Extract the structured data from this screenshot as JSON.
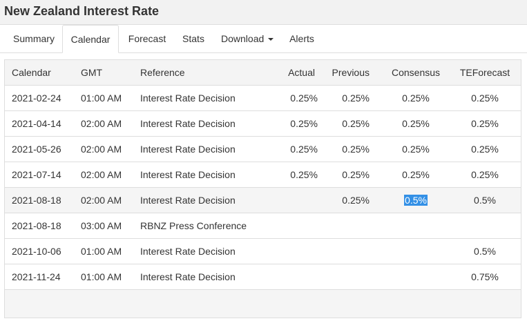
{
  "page": {
    "title": "New Zealand Interest Rate"
  },
  "tabs": [
    {
      "label": "Summary"
    },
    {
      "label": "Calendar"
    },
    {
      "label": "Forecast"
    },
    {
      "label": "Stats"
    },
    {
      "label": "Download"
    },
    {
      "label": "Alerts"
    }
  ],
  "table": {
    "headers": {
      "calendar": "Calendar",
      "gmt": "GMT",
      "reference": "Reference",
      "actual": "Actual",
      "previous": "Previous",
      "consensus": "Consensus",
      "teforecast": "TEForecast"
    },
    "rows": [
      {
        "calendar": "2021-02-24",
        "gmt": "01:00 AM",
        "reference": "Interest Rate Decision",
        "actual": "0.25%",
        "previous": "0.25%",
        "consensus": "0.25%",
        "teforecast": "0.25%"
      },
      {
        "calendar": "2021-04-14",
        "gmt": "02:00 AM",
        "reference": "Interest Rate Decision",
        "actual": "0.25%",
        "previous": "0.25%",
        "consensus": "0.25%",
        "teforecast": "0.25%"
      },
      {
        "calendar": "2021-05-26",
        "gmt": "02:00 AM",
        "reference": "Interest Rate Decision",
        "actual": "0.25%",
        "previous": "0.25%",
        "consensus": "0.25%",
        "teforecast": "0.25%"
      },
      {
        "calendar": "2021-07-14",
        "gmt": "02:00 AM",
        "reference": "Interest Rate Decision",
        "actual": "0.25%",
        "previous": "0.25%",
        "consensus": "0.25%",
        "teforecast": "0.25%"
      },
      {
        "calendar": "2021-08-18",
        "gmt": "02:00 AM",
        "reference": "Interest Rate Decision",
        "actual": "",
        "previous": "0.25%",
        "consensus": "0.5%",
        "teforecast": "0.5%"
      },
      {
        "calendar": "2021-08-18",
        "gmt": "03:00 AM",
        "reference": "RBNZ Press Conference",
        "actual": "",
        "previous": "",
        "consensus": "",
        "teforecast": ""
      },
      {
        "calendar": "2021-10-06",
        "gmt": "01:00 AM",
        "reference": "Interest Rate Decision",
        "actual": "",
        "previous": "",
        "consensus": "",
        "teforecast": "0.5%"
      },
      {
        "calendar": "2021-11-24",
        "gmt": "01:00 AM",
        "reference": "Interest Rate Decision",
        "actual": "",
        "previous": "",
        "consensus": "",
        "teforecast": "0.75%"
      }
    ]
  },
  "colors": {
    "selection": "#3390e6",
    "header_bg": "#f4f4f4",
    "border": "#dddddd"
  }
}
